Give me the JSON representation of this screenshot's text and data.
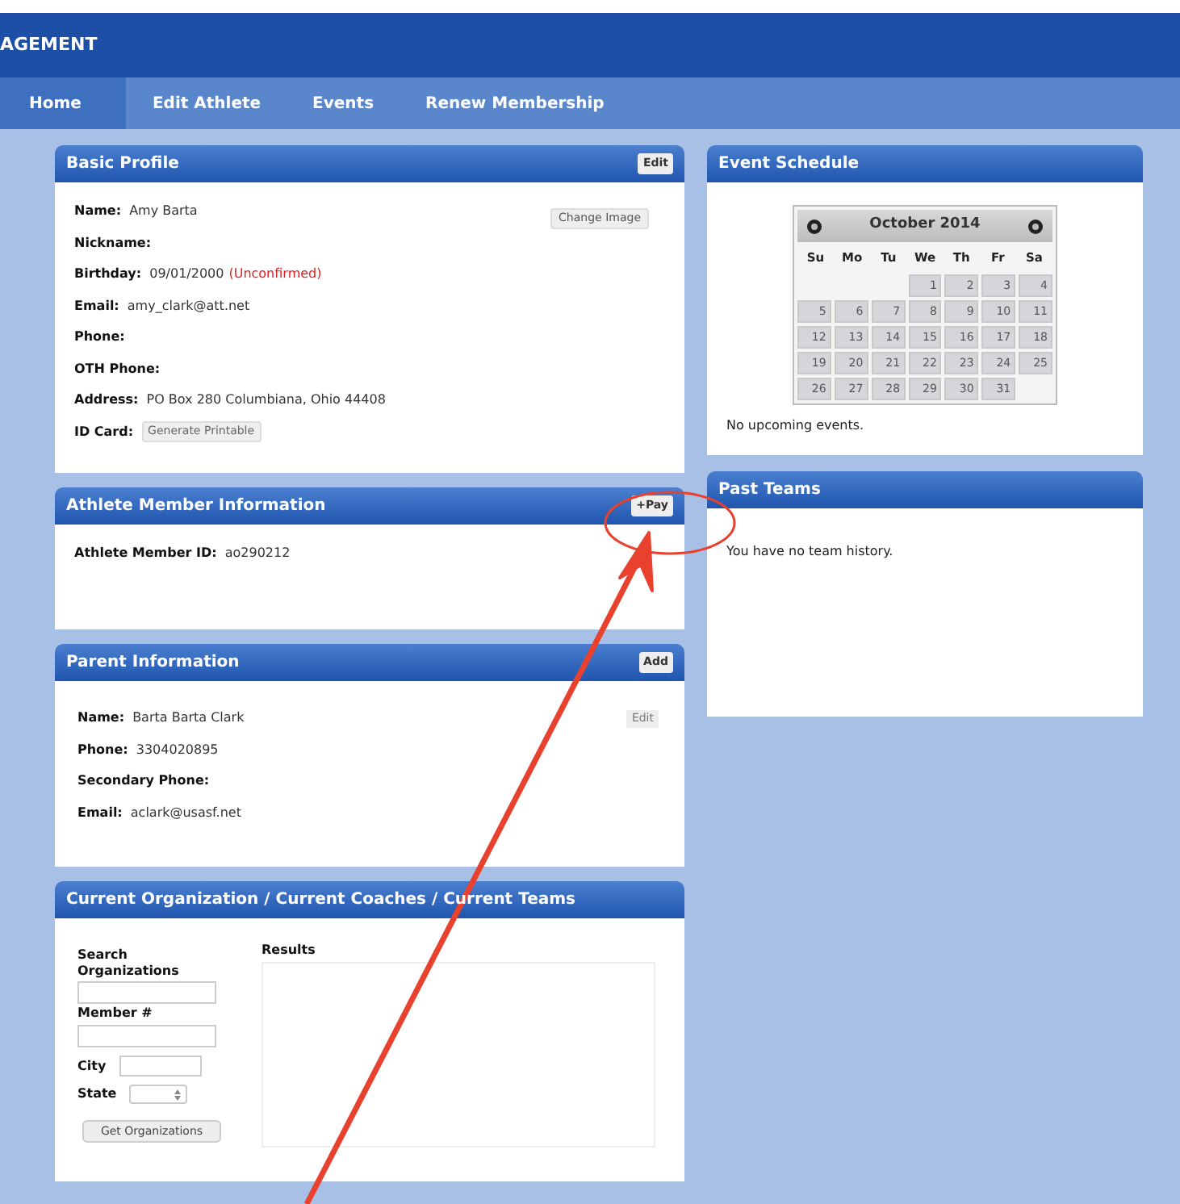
{
  "header": {
    "title": "AGEMENT"
  },
  "nav": {
    "tabs": [
      {
        "label": "Home",
        "selected": true
      },
      {
        "label": "Edit Athlete",
        "selected": false
      },
      {
        "label": "Events",
        "selected": false
      },
      {
        "label": "Renew Membership",
        "selected": false
      }
    ]
  },
  "basic_profile": {
    "title": "Basic Profile",
    "edit_button": "Edit",
    "change_image_button": "Change Image",
    "fields": [
      {
        "kind": "text",
        "label": "Name:",
        "value": "Amy Barta"
      },
      {
        "kind": "text",
        "label": "Nickname:"
      },
      {
        "kind": "text",
        "label": "Birthday:",
        "value": "09/01/2000",
        "note": "(Unconfirmed)"
      },
      {
        "kind": "text",
        "label": "Email:",
        "value": "amy_clark@att.net"
      },
      {
        "kind": "text",
        "label": "Phone:"
      },
      {
        "kind": "text",
        "label": "OTH Phone:"
      },
      {
        "kind": "text",
        "label": "Address:",
        "value": "PO Box 280 Columbiana, Ohio 44408"
      },
      {
        "kind": "button",
        "label": "ID Card:",
        "value": "Generate Printable"
      }
    ]
  },
  "athlete_member": {
    "title": "Athlete Member Information",
    "pay_button": "+Pay",
    "fields": [
      {
        "kind": "text",
        "label": "Athlete Member ID:",
        "value": "ao290212"
      }
    ]
  },
  "parent_info": {
    "title": "Parent Information",
    "add_button": "Add",
    "edit_button": "Edit",
    "fields": [
      {
        "kind": "text",
        "label": "Name:",
        "value": "Barta Barta Clark"
      },
      {
        "kind": "text",
        "label": "Phone:",
        "value": "3304020895"
      },
      {
        "kind": "text",
        "label": "Secondary Phone:"
      },
      {
        "kind": "text",
        "label": "Email:",
        "value": "aclark@usasf.net"
      }
    ]
  },
  "organization_search": {
    "title": "Current Organization / Current Coaches / Current Teams",
    "search_label": "Search Organizations",
    "member_label": "Member #",
    "city_label": "City",
    "state_label": "State",
    "button": "Get Organizations",
    "results_label": "Results"
  },
  "event_schedule": {
    "title": "Event Schedule",
    "calendar": {
      "month": "October 2014",
      "weekdays": [
        "Su",
        "Mo",
        "Tu",
        "We",
        "Th",
        "Fr",
        "Sa"
      ],
      "weeks": [
        [
          "1",
          "2",
          "3",
          "4"
        ],
        [
          "5",
          "6",
          "7",
          "8",
          "9",
          "10",
          "11"
        ],
        [
          "12",
          "13",
          "14",
          "15",
          "16",
          "17",
          "18"
        ],
        [
          "19",
          "20",
          "21",
          "22",
          "23",
          "24",
          "25"
        ],
        [
          "26",
          "27",
          "28",
          "29",
          "30",
          "31"
        ]
      ]
    },
    "empty_message": "No upcoming events."
  },
  "past_teams": {
    "title": "Past Teams",
    "empty_message": "You have no team history."
  },
  "annotations": [
    {
      "kind": "circle"
    },
    {
      "kind": "arrow"
    }
  ]
}
